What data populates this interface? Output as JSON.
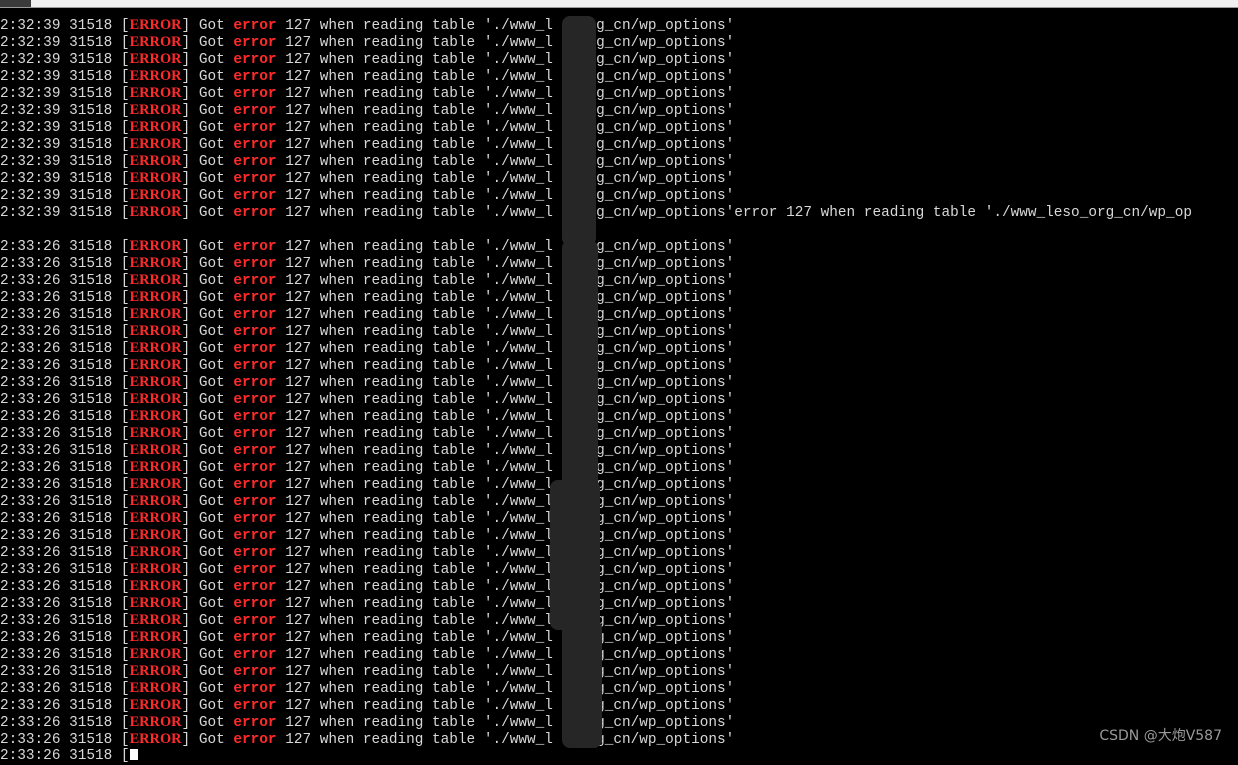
{
  "window": {
    "tab_label": ""
  },
  "terminal": {
    "group1": {
      "time": "2:32:39",
      "pid": "31518",
      "level": "ERROR",
      "prefix": "Got",
      "keyword": "error",
      "message": "127 when reading table './www_l  _org_cn/wp_options'",
      "count": 12,
      "last_line_overflow": "error 127 when reading table './www_leso_org_cn/wp_op"
    },
    "group2": {
      "time": "2:33:26",
      "pid": "31518",
      "level": "ERROR",
      "prefix": "Got",
      "keyword": "error",
      "message": "127 when reading table './www_l  _org_cn/wp_options'",
      "count": 30
    },
    "partial_line": "2:33:26 31518 ["
  },
  "watermark": "CSDN @大炮V587"
}
